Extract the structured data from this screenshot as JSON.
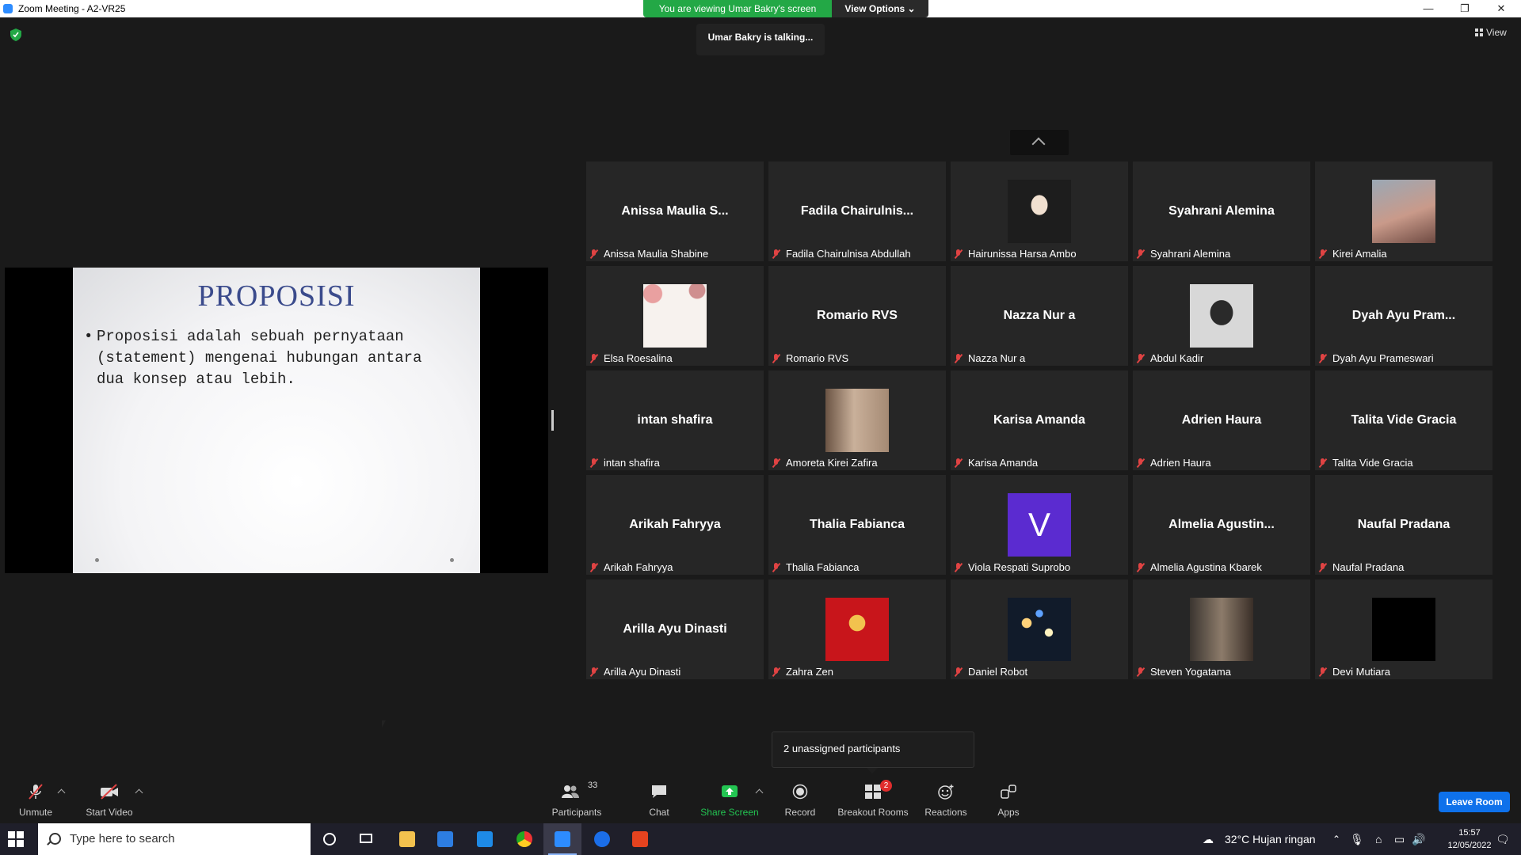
{
  "window": {
    "title": "Zoom Meeting - A2-VR25",
    "minimize": "—",
    "maximize": "❐",
    "close": "✕"
  },
  "banner": {
    "viewing_text": "You are viewing Umar Bakry's screen",
    "view_options": "View Options ⌄"
  },
  "talking_text": "Umar Bakry is talking...",
  "view_button": "View",
  "slide": {
    "title": "PROPOSISI",
    "bullet": "•",
    "lines": [
      "Proposisi adalah sebuah pernyataan",
      "(statement) mengenai hubungan antara",
      "dua konsep atau lebih."
    ]
  },
  "participants": [
    {
      "big": "Anissa Maulia S...",
      "label": "Anissa Maulia Shabine"
    },
    {
      "big": "Fadila  Chairulnis...",
      "label": "Fadila Chairulnisa Abdullah"
    },
    {
      "big": "",
      "label": "Hairunissa Harsa Ambo",
      "avatar": "photo-dark"
    },
    {
      "big": "Syahrani Alemina",
      "label": "Syahrani Alemina"
    },
    {
      "big": "",
      "label": "Kirei Amalia",
      "avatar": "photo-city"
    },
    {
      "big": "",
      "label": "Elsa Roesalina",
      "avatar": "photo-floral"
    },
    {
      "big": "Romario RVS",
      "label": "Romario RVS"
    },
    {
      "big": "Nazza Nur a",
      "label": "Nazza Nur a"
    },
    {
      "big": "",
      "label": "Abdul Kadir",
      "avatar": "photo-bw"
    },
    {
      "big": "Dyah Ayu Pram...",
      "label": "Dyah Ayu Prameswari"
    },
    {
      "big": "intan shafira",
      "label": "intan shafira"
    },
    {
      "big": "",
      "label": "Amoreta Kirei Zafira",
      "avatar": "photo-sepia"
    },
    {
      "big": "Karisa Amanda",
      "label": "Karisa Amanda"
    },
    {
      "big": "Adrien Haura",
      "label": "Adrien Haura"
    },
    {
      "big": "Talita Vide Gracia",
      "label": "Talita Vide Gracia"
    },
    {
      "big": "Arikah Fahryya",
      "label": "Arikah Fahryya"
    },
    {
      "big": "Thalia Fabianca",
      "label": "Thalia Fabianca"
    },
    {
      "big": "",
      "label": "Viola Respati Suprobo",
      "avatar": "letter",
      "letter": "V"
    },
    {
      "big": "Almelia  Agustin...",
      "label": "Almelia Agustina Kbarek"
    },
    {
      "big": "Naufal Pradana",
      "label": "Naufal Pradana"
    },
    {
      "big": "Arilla Ayu Dinasti",
      "label": "Arilla Ayu Dinasti"
    },
    {
      "big": "",
      "label": "Zahra Zen",
      "avatar": "photo-red"
    },
    {
      "big": "",
      "label": "Daniel Robot",
      "avatar": "photo-bokeh"
    },
    {
      "big": "",
      "label": "Steven Yogatama",
      "avatar": "photo-street"
    },
    {
      "big": "",
      "label": "Devi Mutiara",
      "avatar": "black"
    }
  ],
  "unassigned_text": "2 unassigned participants",
  "toolbar": {
    "unmute": "Unmute",
    "start_video": "Start Video",
    "participants": "Participants",
    "participants_count": "33",
    "chat": "Chat",
    "share_screen": "Share Screen",
    "record": "Record",
    "breakout_rooms": "Breakout Rooms",
    "breakout_badge": "2",
    "reactions": "Reactions",
    "apps": "Apps",
    "leave_room": "Leave Room"
  },
  "taskbar": {
    "search_placeholder": "Type here to search",
    "weather": "32°C  Hujan ringan",
    "time": "15:57",
    "date": "12/05/2022"
  },
  "colors": {
    "share_green": "#23a846",
    "leave_blue": "#0e71eb",
    "mute_red": "#e04343",
    "slide_title": "#3b4b8c",
    "viola_purple": "#5b2bd0"
  }
}
